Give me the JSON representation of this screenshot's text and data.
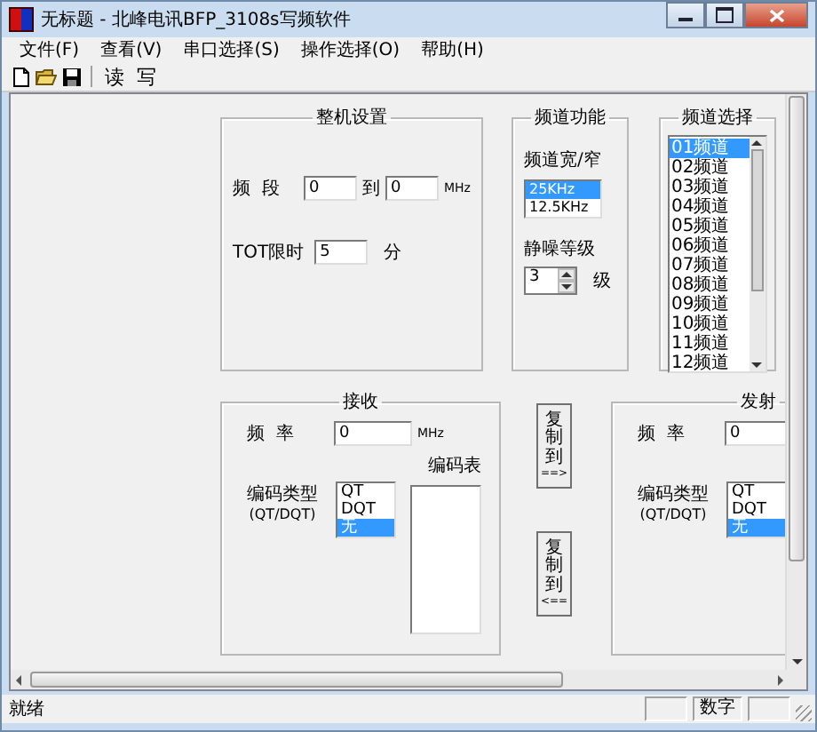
{
  "window": {
    "title": "无标题 - 北峰电讯BFP_3108s写频软件"
  },
  "menu": [
    "文件(F)",
    "查看(V)",
    "串口选择(S)",
    "操作选择(O)",
    "帮助(H)"
  ],
  "toolbar": [
    {
      "kind": "new"
    },
    {
      "kind": "open"
    },
    {
      "kind": "save"
    },
    {
      "kind": "separator"
    },
    {
      "kind": "text",
      "label": "读"
    },
    {
      "kind": "text",
      "label": "写"
    }
  ],
  "machine_settings": {
    "title": "整机设置",
    "band_label": "频  段",
    "band_from": "0",
    "to_label": "到",
    "band_to": "0",
    "unit": "MHz",
    "tot_label": "TOT限时",
    "tot_value": "5",
    "tot_unit": "分"
  },
  "channel_function": {
    "title": "频道功能",
    "width_label": "频道宽/窄",
    "width_options": [
      {
        "label": "25KHz",
        "selected": true
      },
      {
        "label": "12.5KHz",
        "selected": false
      }
    ],
    "squelch_label": "静噪等级",
    "squelch_value": "3",
    "squelch_unit": "级"
  },
  "channel_select": {
    "title": "频道选择",
    "channels": [
      {
        "label": "01频道",
        "selected": true
      },
      {
        "label": "02频道",
        "selected": false
      },
      {
        "label": "03频道",
        "selected": false
      },
      {
        "label": "04频道",
        "selected": false
      },
      {
        "label": "05频道",
        "selected": false
      },
      {
        "label": "06频道",
        "selected": false
      },
      {
        "label": "07频道",
        "selected": false
      },
      {
        "label": "08频道",
        "selected": false
      },
      {
        "label": "09频道",
        "selected": false
      },
      {
        "label": "10频道",
        "selected": false
      },
      {
        "label": "11频道",
        "selected": false
      },
      {
        "label": "12频道",
        "selected": false
      }
    ]
  },
  "receive": {
    "title": "接收",
    "freq_label": "频  率",
    "freq_value": "0",
    "unit": "MHz",
    "code_type_label": "编码类型",
    "code_type_hint": "(QT/DQT)",
    "code_types": [
      {
        "label": "QT",
        "selected": false
      },
      {
        "label": "DQT",
        "selected": false
      },
      {
        "label": "无",
        "selected": true
      }
    ],
    "code_table_label": "编码表"
  },
  "copy_buttons": [
    {
      "label": "复制到",
      "arrow": "==>"
    },
    {
      "label": "复制到",
      "arrow": "<=="
    }
  ],
  "transmit": {
    "title": "发射",
    "freq_label": "频  率",
    "freq_value": "0",
    "code_type_label": "编码类型",
    "code_type_hint": "(QT/DQT)",
    "code_types": [
      {
        "label": "QT",
        "selected": false
      },
      {
        "label": "DQT",
        "selected": false
      },
      {
        "label": "无",
        "selected": true
      }
    ]
  },
  "status_bar": {
    "text": "就绪",
    "panels": [
      "数字"
    ]
  }
}
